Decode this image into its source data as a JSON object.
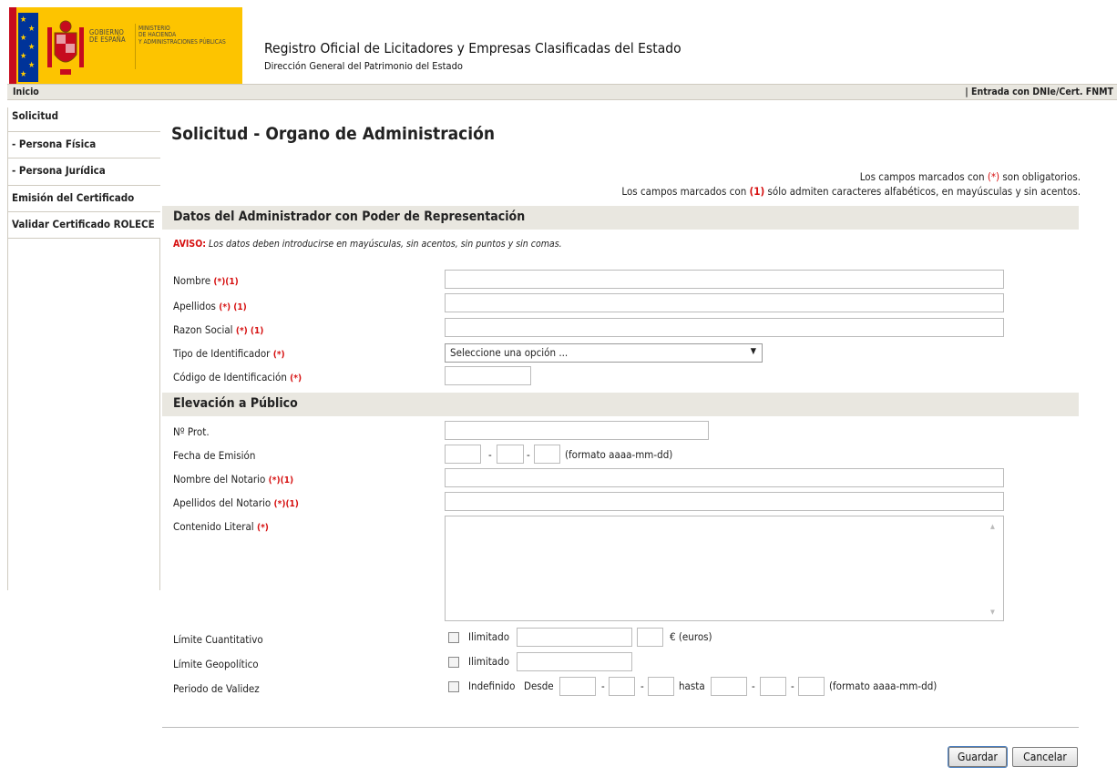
{
  "header": {
    "site_title": "Registro Oficial de Licitadores y Empresas Clasificadas del Estado",
    "site_subtitle": "Dirección General del Patrimonio del Estado",
    "logo_gobierno": [
      "GOBIERNO",
      "DE ESPAÑA"
    ],
    "logo_ministerio": [
      "MINISTERIO",
      "DE HACIENDA",
      "Y ADMINISTRACIONES PÚBLICAS"
    ]
  },
  "nav": {
    "inicio": "Inicio",
    "entrada": "| Entrada con DNIe/Cert. FNMT"
  },
  "sidebar": {
    "items": [
      {
        "label": "Solicitud"
      },
      {
        "label": " - Persona Física"
      },
      {
        "label": " - Persona Jurídica"
      },
      {
        "label": "Emisión del Certificado"
      },
      {
        "label": "Validar Certificado ROLECE"
      }
    ]
  },
  "main": {
    "title": "Solicitud - Organo de Administración",
    "note1_pre": "Los campos marcados con ",
    "note1_mark": "(*)",
    "note1_post": " son obligatorios.",
    "note2_pre": "Los campos marcados con ",
    "note2_mark": "(1)",
    "note2_post": " sólo admiten caracteres alfabéticos, en mayúsculas y sin acentos.",
    "section1": "Datos del Administrador con Poder de Representación",
    "aviso_label": "AVISO:",
    "aviso_text": " Los datos deben introducirse en mayúsculas, sin acentos, sin puntos y sin comas.",
    "section2": "Elevación a Público"
  },
  "fields": {
    "nombre": {
      "label": "Nombre ",
      "req": "(*)(1)",
      "value": ""
    },
    "apellidos": {
      "label": "Apellidos ",
      "req": "(*) (1)",
      "value": ""
    },
    "razon_social": {
      "label": "Razon Social ",
      "req": "(*) (1)",
      "value": ""
    },
    "tipo_identificador": {
      "label": "Tipo de Identificador ",
      "req": "(*)",
      "selected": "Seleccione una opción ..."
    },
    "codigo_identificacion": {
      "label": "Código de Identificación ",
      "req": "(*)",
      "value": ""
    },
    "n_prot": {
      "label": "Nº Prot.",
      "value": ""
    },
    "fecha_emision": {
      "label": "Fecha de Emisión",
      "format": "(formato aaaa-mm-dd)",
      "dash": "-"
    },
    "nombre_notario": {
      "label": "Nombre del Notario ",
      "req": "(*)(1)",
      "value": ""
    },
    "apellidos_notario": {
      "label": "Apellidos del Notario ",
      "req": "(*)(1)",
      "value": ""
    },
    "contenido_literal": {
      "label": "Contenido Literal ",
      "req": "(*)",
      "value": ""
    },
    "limite_cuantitativo": {
      "label": "Límite Cuantitativo",
      "check_label": "Ilimitado",
      "currency": "€ (euros)"
    },
    "limite_geopolitico": {
      "label": "Límite Geopolítico",
      "check_label": "Ilimitado"
    },
    "periodo_validez": {
      "label": "Periodo de Validez",
      "check_label": "Indefinido",
      "desde": "Desde",
      "hasta": "hasta",
      "format": "(formato aaaa-mm-dd)"
    }
  },
  "buttons": {
    "guardar": "Guardar",
    "cancelar": "Cancelar"
  },
  "colors": {
    "required_mark": "#d61010",
    "section_bg": "#e9e7e0",
    "logo_yellow": "#fdc400",
    "flag_red": "#c60b1e",
    "eu_blue": "#003399"
  }
}
